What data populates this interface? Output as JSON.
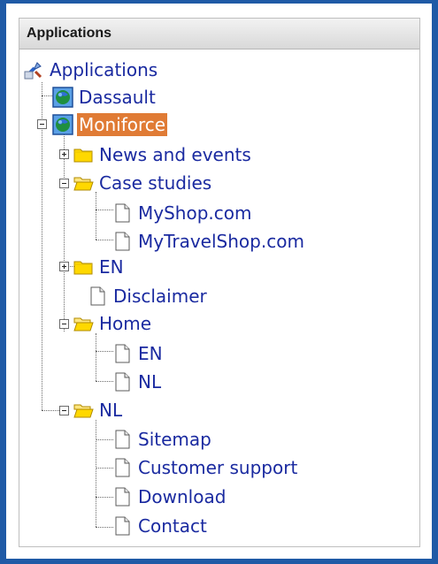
{
  "panel": {
    "title": "Applications"
  },
  "tree": {
    "root_label": "Applications",
    "dassault": "Dassault",
    "moniforce": "Moniforce",
    "news_and_events": "News and events",
    "case_studies": "Case studies",
    "myshop": "MyShop.com",
    "mytravelshop": "MyTravelShop.com",
    "en_folder": "EN",
    "disclaimer": "Disclaimer",
    "home": "Home",
    "home_en": "EN",
    "home_nl": "NL",
    "nl_folder": "NL",
    "sitemap": "Sitemap",
    "customer_support": "Customer support",
    "download": "Download",
    "contact": "Contact"
  },
  "icons": {
    "root": "applications-tool-icon",
    "site": "globe-icon",
    "folder": "folder-icon",
    "folder_open": "folder-open-icon",
    "page": "page-icon"
  },
  "colors": {
    "frame": "#1f5aa6",
    "link": "#1a2aa0",
    "selection": "#e07b35",
    "folder": "#ffd800"
  }
}
